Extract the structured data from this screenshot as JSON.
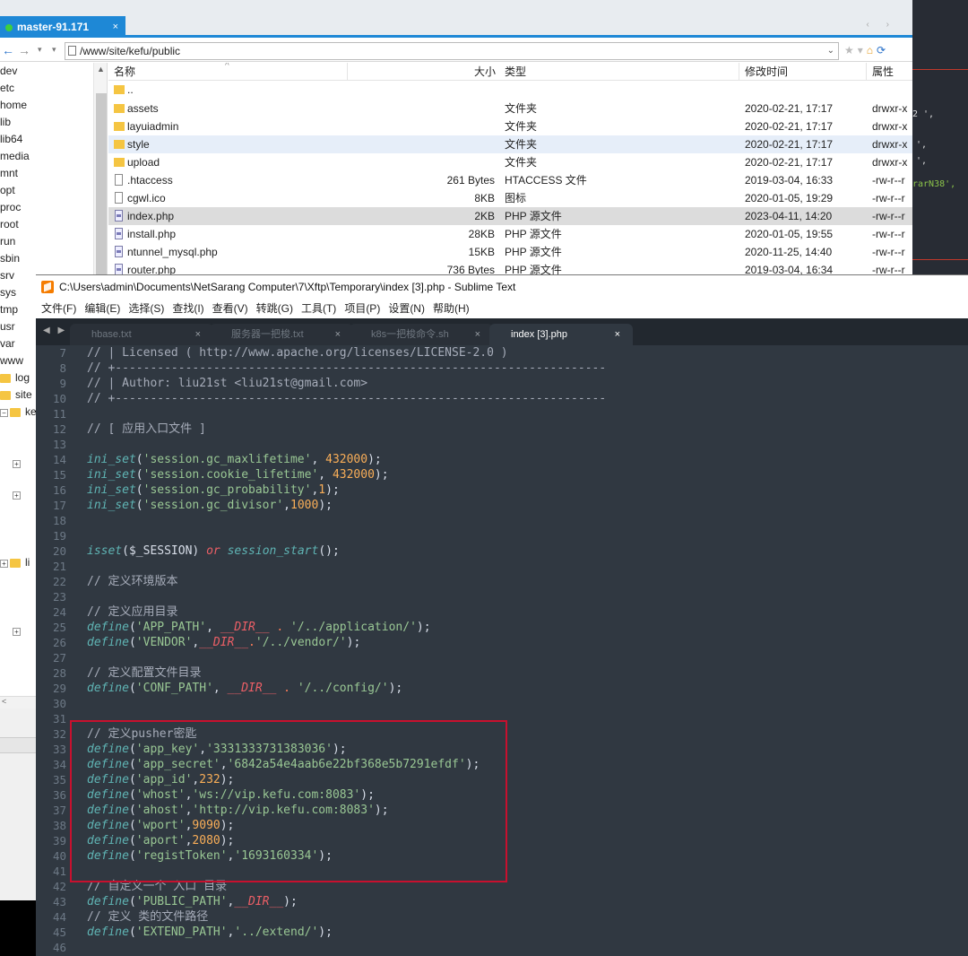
{
  "xftp": {
    "tab_title": "master-91.171",
    "tab_close": "×",
    "scroll_arrows": "‹ ›",
    "address": "/www/site/kefu/public",
    "address_dropdown": "⌄",
    "tree_items": [
      "dev",
      "etc",
      "home",
      "lib",
      "lib64",
      "media",
      "mnt",
      "opt",
      "proc",
      "root",
      "run",
      "sbin",
      "srv",
      "sys",
      "tmp",
      "usr",
      "var",
      "www"
    ],
    "tree_sub": {
      "log": "log",
      "site": "site",
      "ke": "ke",
      "li": "li"
    },
    "columns": {
      "name": "名称",
      "size": "大小",
      "type": "类型",
      "mtime": "修改时间",
      "attr": "属性"
    },
    "rows": [
      {
        "name": "..",
        "size": "",
        "type": "",
        "mtime": "",
        "attr": "",
        "icon": "folder"
      },
      {
        "name": "assets",
        "size": "",
        "type": "文件夹",
        "mtime": "2020-02-21, 17:17",
        "attr": "drwxr-x",
        "icon": "folder"
      },
      {
        "name": "layuiadmin",
        "size": "",
        "type": "文件夹",
        "mtime": "2020-02-21, 17:17",
        "attr": "drwxr-x",
        "icon": "folder"
      },
      {
        "name": "style",
        "size": "",
        "type": "文件夹",
        "mtime": "2020-02-21, 17:17",
        "attr": "drwxr-x",
        "icon": "folder"
      },
      {
        "name": "upload",
        "size": "",
        "type": "文件夹",
        "mtime": "2020-02-21, 17:17",
        "attr": "drwxr-x",
        "icon": "folder"
      },
      {
        "name": ".htaccess",
        "size": "261 Bytes",
        "type": "HTACCESS 文件",
        "mtime": "2019-03-04, 16:33",
        "attr": "-rw-r--r",
        "icon": "file"
      },
      {
        "name": "cgwl.ico",
        "size": "8KB",
        "type": "图标",
        "mtime": "2020-01-05, 19:29",
        "attr": "-rw-r--r",
        "icon": "file"
      },
      {
        "name": "index.php",
        "size": "2KB",
        "type": "PHP 源文件",
        "mtime": "2023-04-11, 14:20",
        "attr": "-rw-r--r",
        "icon": "php"
      },
      {
        "name": "install.php",
        "size": "28KB",
        "type": "PHP 源文件",
        "mtime": "2020-01-05, 19:55",
        "attr": "-rw-r--r",
        "icon": "php"
      },
      {
        "name": "ntunnel_mysql.php",
        "size": "15KB",
        "type": "PHP 源文件",
        "mtime": "2020-11-25, 14:40",
        "attr": "-rw-r--r",
        "icon": "php"
      },
      {
        "name": "router.php",
        "size": "736 Bytes",
        "type": "PHP 源文件",
        "mtime": "2019-03-04, 16:34",
        "attr": "-rw-r--r",
        "icon": "php"
      }
    ]
  },
  "terminal": {
    "frag1": "2 ',",
    "frag2": "',",
    "frag3": "',",
    "frag4": "rarN38',"
  },
  "sublime": {
    "title": "C:\\Users\\admin\\Documents\\NetSarang Computer\\7\\Xftp\\Temporary\\index [3].php - Sublime Text",
    "menu": [
      "文件(F)",
      "编辑(E)",
      "选择(S)",
      "查找(I)",
      "查看(V)",
      "转跳(G)",
      "工具(T)",
      "项目(P)",
      "设置(N)",
      "帮助(H)"
    ],
    "tab_arrows": "◀ ▶",
    "tabs": [
      {
        "label": "hbase.txt",
        "close": "×"
      },
      {
        "label": "服务器一把梭.txt",
        "close": "×"
      },
      {
        "label": "k8s一把梭命令.sh",
        "close": "×"
      },
      {
        "label": "index [3].php",
        "close": "×"
      }
    ],
    "line_numbers": [
      "7",
      "8",
      "9",
      "10",
      "11",
      "12",
      "13",
      "14",
      "15",
      "16",
      "17",
      "18",
      "19",
      "20",
      "21",
      "22",
      "23",
      "24",
      "25",
      "26",
      "27",
      "28",
      "29",
      "30",
      "31",
      "32",
      "33",
      "34",
      "35",
      "36",
      "37",
      "38",
      "39",
      "40",
      "41",
      "42",
      "43",
      "44",
      "45",
      "46"
    ],
    "code": {
      "l7": "// | Licensed ( http://www.apache.org/licenses/LICENSE-2.0 )",
      "l8": "// +----------------------------------------------------------------------",
      "l9": "// | Author: liu21st <liu21st@gmail.com>",
      "l10": "// +----------------------------------------------------------------------",
      "l12": "// [ 应用入口文件 ]",
      "l14_fn": "ini_set",
      "l14_a": "'session.gc_maxlifetime'",
      "l14_b": "432000",
      "l15_fn": "ini_set",
      "l15_a": "'session.cookie_lifetime'",
      "l15_b": "432000",
      "l16_fn": "ini_set",
      "l16_a": "'session.gc_probability'",
      "l16_b": "1",
      "l17_fn": "ini_set",
      "l17_a": "'session.gc_divisor'",
      "l17_b": "1000",
      "l20_fn": "isset",
      "l20_var": "$_SESSION",
      "l20_or": "or",
      "l20_fn2": "session_start",
      "l22": "// 定义环境版本",
      "l24": "// 定义应用目录",
      "l25_fn": "define",
      "l25_a": "'APP_PATH'",
      "l25_dir": "__DIR__",
      "l25_b": "'/../application/'",
      "l26_fn": "define",
      "l26_a": "'VENDOR'",
      "l26_dir": "__DIR__",
      "l26_b": "'/../vendor/'",
      "l28": "// 定义配置文件目录",
      "l29_fn": "define",
      "l29_a": "'CONF_PATH'",
      "l29_dir": "__DIR__",
      "l29_b": "'/../config/'",
      "l32": "// 定义pusher密匙",
      "l33_fn": "define",
      "l33_a": "'app_key'",
      "l33_b": "'3331333731383036'",
      "l34_fn": "define",
      "l34_a": "'app_secret'",
      "l34_b": "'6842a54e4aab6e22bf368e5b7291efdf'",
      "l35_fn": "define",
      "l35_a": "'app_id'",
      "l35_b": "232",
      "l36_fn": "define",
      "l36_a": "'whost'",
      "l36_b": "'ws://vip.kefu.com:8083'",
      "l37_fn": "define",
      "l37_a": "'ahost'",
      "l37_b": "'http://vip.kefu.com:8083'",
      "l38_fn": "define",
      "l38_a": "'wport'",
      "l38_b": "9090",
      "l39_fn": "define",
      "l39_a": "'aport'",
      "l39_b": "2080",
      "l40_fn": "define",
      "l40_a": "'registToken'",
      "l40_b": "'1693160334'",
      "l42": "// 自定义一个 入口 目录",
      "l43_fn": "define",
      "l43_a": "'PUBLIC_PATH'",
      "l43_dir": "__DIR__",
      "l44": "// 定义 类的文件路径",
      "l45_fn": "define",
      "l45_a": "'EXTEND_PATH'",
      "l45_b": "'../extend/'"
    }
  },
  "colors": {
    "xftp_accent": "#1e88d6",
    "editor_bg": "#303841",
    "highlight_box": "#c8102e",
    "string": "#99c794",
    "number": "#f9ae58",
    "function": "#5fb4b4",
    "keyword": "#ec5f66"
  }
}
